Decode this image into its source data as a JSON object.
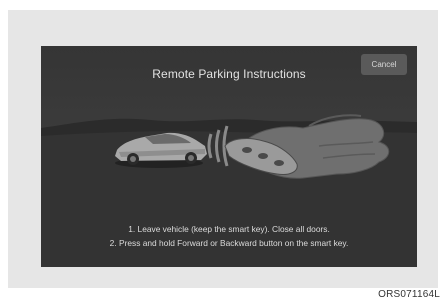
{
  "screen": {
    "title": "Remote Parking Instructions",
    "cancel_label": "Cancel",
    "instructions": [
      "1. Leave vehicle (keep the smart key). Close all doors.",
      "2. Press and hold Forward or Backward button on the smart key."
    ]
  },
  "figure_code": "ORS071164L"
}
